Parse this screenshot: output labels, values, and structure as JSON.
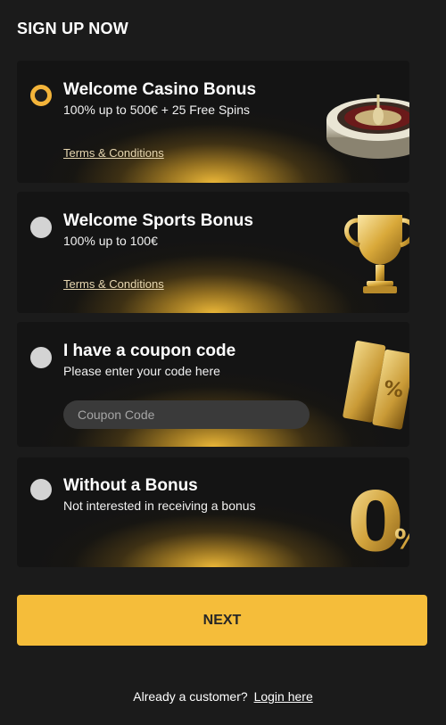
{
  "header": {
    "title": "SIGN UP NOW"
  },
  "options": [
    {
      "title": "Welcome Casino Bonus",
      "subtitle": "100% up to 500€ + 25 Free Spins",
      "terms": "Terms & Conditions",
      "selected": true,
      "icon": "roulette-icon"
    },
    {
      "title": "Welcome Sports Bonus",
      "subtitle": "100% up to 100€",
      "terms": "Terms & Conditions",
      "selected": false,
      "icon": "trophy-icon"
    },
    {
      "title": "I have a coupon code",
      "subtitle": "Please enter your code here",
      "coupon_placeholder": "Coupon Code",
      "coupon_value": "",
      "selected": false,
      "icon": "coupon-tickets-icon"
    },
    {
      "title": "Without a Bonus",
      "subtitle": "Not interested in receiving a bonus",
      "selected": false,
      "icon": "zero-percent-icon",
      "icon_text_digit": "0",
      "icon_text_percent": "%"
    }
  ],
  "next_label": "NEXT",
  "footer": {
    "prompt": "Already a customer?",
    "login_link": "Login here"
  },
  "colors": {
    "accent": "#f5bd3a",
    "background": "#1b1b1b",
    "card": "#141414"
  }
}
